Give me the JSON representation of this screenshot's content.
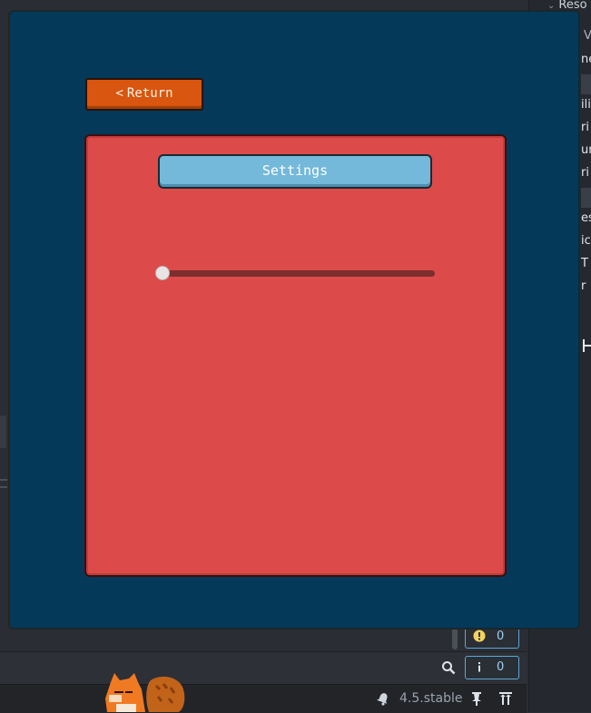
{
  "editor": {
    "inspector_header": "Reso",
    "inspector_sub": "V",
    "inspector_lines": [
      "ne",
      "ili",
      "ri",
      "ur",
      "ri",
      "es",
      "ic",
      "T",
      "r"
    ],
    "warnings_count": "0",
    "info_count": "0",
    "version": "4.5.stable"
  },
  "game": {
    "return_label": "Return",
    "return_glyph": "<",
    "settings_title": "Settings",
    "slider_value": 0
  },
  "colors": {
    "window_bg": "#04395a",
    "panel_bg": "#dc4a4a",
    "return_bg": "#d8560f",
    "title_bg": "#74b8da",
    "slider_track": "#7c2d2d"
  }
}
